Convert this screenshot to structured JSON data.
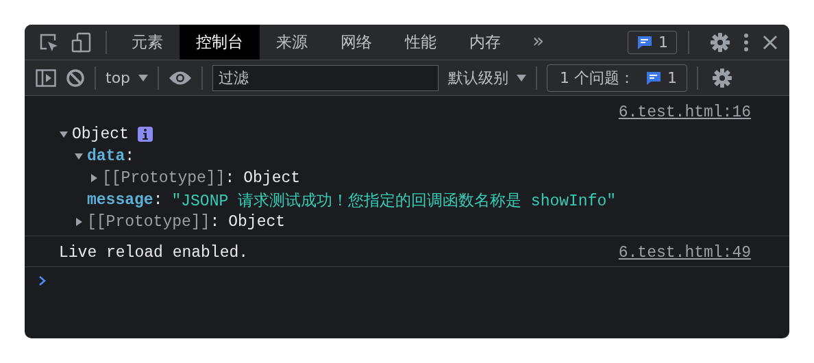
{
  "tabs": [
    {
      "label": "元素",
      "selected": false
    },
    {
      "label": "控制台",
      "selected": true
    },
    {
      "label": "来源",
      "selected": false
    },
    {
      "label": "网络",
      "selected": false
    },
    {
      "label": "性能",
      "selected": false
    },
    {
      "label": "内存",
      "selected": false
    }
  ],
  "more_tabs": "»",
  "issues_badge": {
    "count": "1"
  },
  "toolbar": {
    "context": "top",
    "filter": {
      "placeholder": "过滤"
    },
    "log_level": "默认级别",
    "issues": {
      "label": "1 个问题：",
      "count": "1"
    }
  },
  "console": [
    {
      "kind": "object",
      "source": "6.test.html:16",
      "tree": {
        "label": "Object",
        "expanded": true,
        "children": [
          {
            "key": "data",
            "kind": "own",
            "separator": ":",
            "expanded": true,
            "children": [
              {
                "key": "[[Prototype]]",
                "kind": "internal",
                "separator": ":",
                "value": {
                  "text": "Object",
                  "kind": "object"
                },
                "expanded": false
              }
            ]
          },
          {
            "key": "message",
            "kind": "own",
            "separator": ":",
            "value": {
              "text": "\"JSONP 请求测试成功！您指定的回调函数名称是 showInfo\"",
              "kind": "string"
            }
          },
          {
            "key": "[[Prototype]]",
            "kind": "internal",
            "separator": ":",
            "value": {
              "text": "Object",
              "kind": "object"
            },
            "expanded": false
          }
        ]
      }
    },
    {
      "kind": "log",
      "text": "Live reload enabled.",
      "source": "6.test.html:49"
    }
  ]
}
